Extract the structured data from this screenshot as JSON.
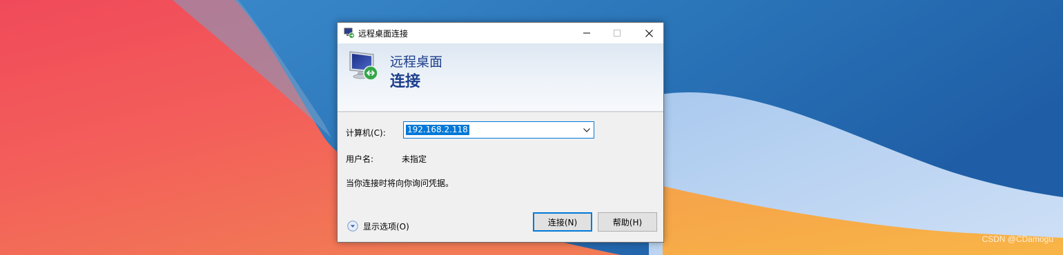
{
  "window": {
    "title": "远程桌面连接",
    "banner_line1": "远程桌面",
    "banner_line2": "连接"
  },
  "form": {
    "computer_label": "计算机(C):",
    "computer_value": "192.168.2.118",
    "username_label": "用户名:",
    "username_value": "未指定",
    "credentials_note": "当你连接时将向你询问凭据。"
  },
  "footer": {
    "show_options": "显示选项(O)",
    "connect_button": "连接(N)",
    "help_button": "帮助(H)"
  },
  "watermark": "CSDN @CDamogu",
  "icons": [
    "remote-desktop-icon",
    "minimize-icon",
    "maximize-icon",
    "close-icon",
    "monitor-icon",
    "chevron-down-icon",
    "expand-options-icon"
  ],
  "colors": {
    "accent": "#0078d7",
    "banner_text": "#1d3f8c"
  }
}
